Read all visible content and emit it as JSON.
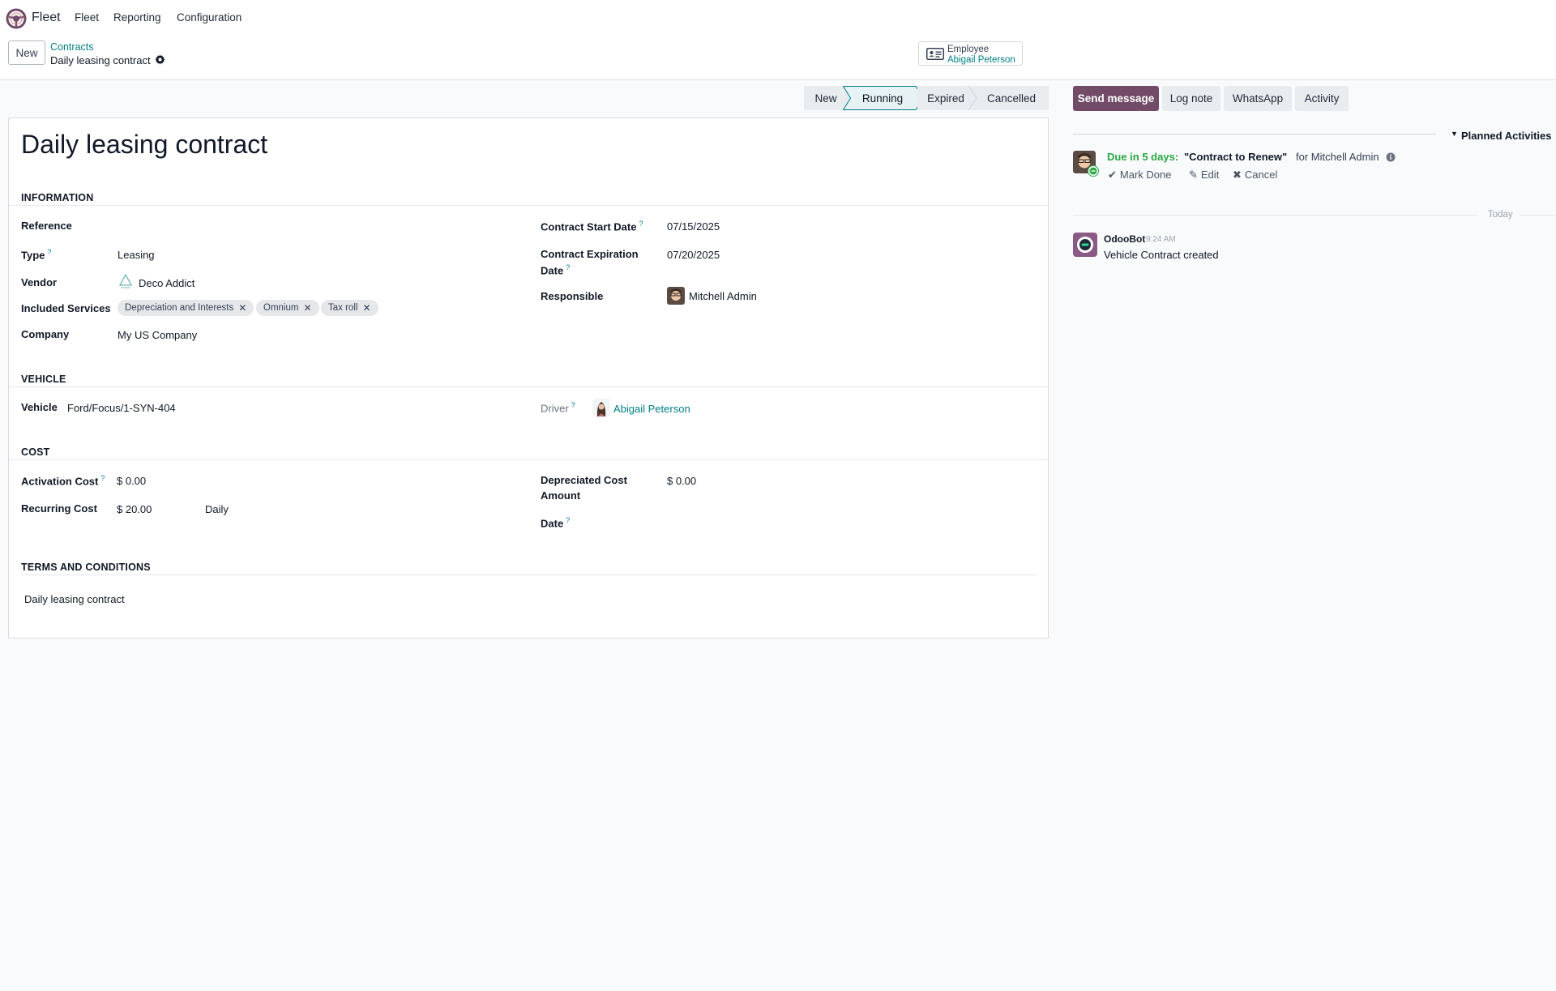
{
  "nav": {
    "app_name": "Fleet",
    "menu": [
      "Fleet",
      "Reporting",
      "Configuration"
    ]
  },
  "control": {
    "new_label": "New",
    "breadcrumb_parent": "Contracts",
    "breadcrumb_current": "Daily leasing contract",
    "employee_label": "Employee",
    "employee_value": "Abigail Peterson"
  },
  "statusbar": {
    "stages": [
      "New",
      "Running",
      "Expired",
      "Cancelled"
    ],
    "active": "Running"
  },
  "form": {
    "title": "Daily leasing contract",
    "sections": {
      "information": "INFORMATION",
      "vehicle": "VEHICLE",
      "cost": "COST",
      "terms": "TERMS AND CONDITIONS"
    },
    "info": {
      "reference_label": "Reference",
      "reference_value": "",
      "type_label": "Type",
      "type_value": "Leasing",
      "vendor_label": "Vendor",
      "vendor_value": "Deco Addict",
      "services_label": "Included Services",
      "services": [
        "Depreciation and Interests",
        "Omnium",
        "Tax roll"
      ],
      "company_label": "Company",
      "company_value": "My US Company",
      "start_label": "Contract Start Date",
      "start_value": "07/15/2025",
      "expiration_label_1": "Contract Expiration",
      "expiration_label_2": "Date",
      "expiration_value": "07/20/2025",
      "responsible_label": "Responsible",
      "responsible_value": "Mitchell Admin"
    },
    "vehicle": {
      "vehicle_label": "Vehicle",
      "vehicle_value": "Ford/Focus/1-SYN-404",
      "driver_label": "Driver",
      "driver_value": "Abigail Peterson"
    },
    "cost": {
      "activation_label": "Activation Cost",
      "activation_value": "$ 0.00",
      "recurring_label": "Recurring Cost",
      "recurring_value": "$ 20.00",
      "recurring_period": "Daily",
      "depreciated_label_1": "Depreciated Cost",
      "depreciated_label_2": "Amount",
      "depreciated_value": "$ 0.00",
      "date_label": "Date",
      "date_value": ""
    },
    "terms_value": "Daily leasing contract",
    "help_mark": "?"
  },
  "chatter": {
    "send_message": "Send message",
    "log_note": "Log note",
    "whatsapp": "WhatsApp",
    "activity": "Activity",
    "planned_label": "Planned Activities",
    "activity_due": "Due in 5 days:",
    "activity_summary": "\"Contract to Renew\"",
    "activity_for": "for Mitchell Admin",
    "mark_done": "Mark Done",
    "edit": "Edit",
    "cancel": "Cancel",
    "today": "Today",
    "message_author": "OdooBot",
    "message_time": "9:24 AM",
    "message_body": "Vehicle Contract created"
  },
  "colors": {
    "brand": "#714b67",
    "link": "#017e84",
    "due": "#28a745"
  }
}
